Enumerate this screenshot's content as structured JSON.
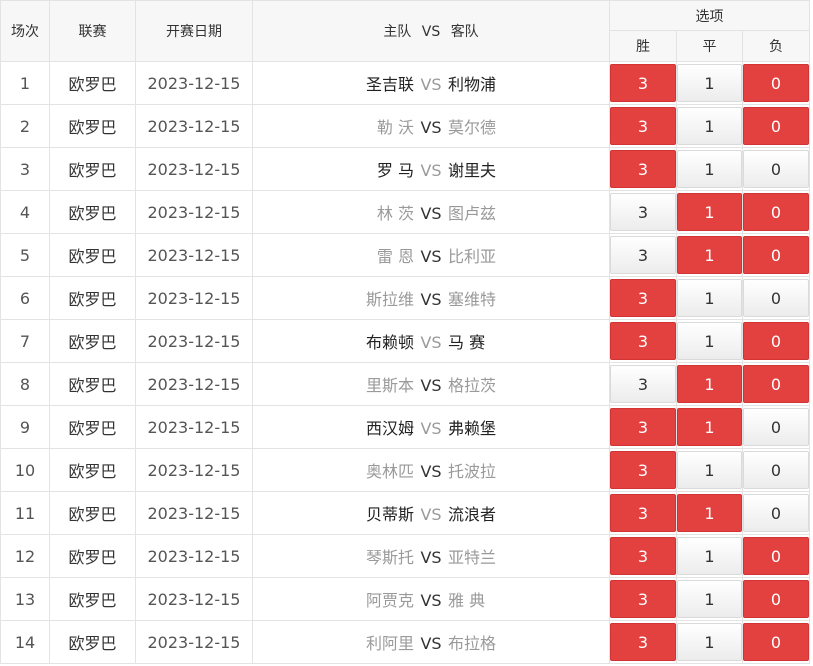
{
  "header": {
    "no": "场次",
    "league": "联赛",
    "date": "开赛日期",
    "home": "主队",
    "vs": "VS",
    "away": "客队",
    "options": "选项",
    "win": "胜",
    "draw": "平",
    "lose": "负"
  },
  "colors": {
    "selected": "#e34040",
    "unselected": "#f2f2f2",
    "border": "#e3e3e3",
    "header_bg": "#f7f7f7"
  },
  "rows": [
    {
      "no": "1",
      "league": "欧罗巴",
      "date": "2023-12-15",
      "home": "圣吉联",
      "away": "利物浦",
      "home_style": "dark",
      "away_style": "dark",
      "vs_style": "grey",
      "win": "3",
      "draw": "1",
      "lose": "0",
      "win_sel": true,
      "draw_sel": false,
      "lose_sel": true
    },
    {
      "no": "2",
      "league": "欧罗巴",
      "date": "2023-12-15",
      "home": "勒 沃",
      "away": "莫尔德",
      "home_style": "grey",
      "away_style": "grey",
      "vs_style": "dark",
      "win": "3",
      "draw": "1",
      "lose": "0",
      "win_sel": true,
      "draw_sel": false,
      "lose_sel": true
    },
    {
      "no": "3",
      "league": "欧罗巴",
      "date": "2023-12-15",
      "home": "罗 马",
      "away": "谢里夫",
      "home_style": "dark",
      "away_style": "dark",
      "vs_style": "grey",
      "win": "3",
      "draw": "1",
      "lose": "0",
      "win_sel": true,
      "draw_sel": false,
      "lose_sel": false
    },
    {
      "no": "4",
      "league": "欧罗巴",
      "date": "2023-12-15",
      "home": "林 茨",
      "away": "图卢兹",
      "home_style": "grey",
      "away_style": "grey",
      "vs_style": "dark",
      "win": "3",
      "draw": "1",
      "lose": "0",
      "win_sel": false,
      "draw_sel": true,
      "lose_sel": true
    },
    {
      "no": "5",
      "league": "欧罗巴",
      "date": "2023-12-15",
      "home": "雷 恩",
      "away": "比利亚",
      "home_style": "grey",
      "away_style": "grey",
      "vs_style": "dark",
      "win": "3",
      "draw": "1",
      "lose": "0",
      "win_sel": false,
      "draw_sel": true,
      "lose_sel": true
    },
    {
      "no": "6",
      "league": "欧罗巴",
      "date": "2023-12-15",
      "home": "斯拉维",
      "away": "塞维特",
      "home_style": "grey",
      "away_style": "grey",
      "vs_style": "dark",
      "win": "3",
      "draw": "1",
      "lose": "0",
      "win_sel": true,
      "draw_sel": false,
      "lose_sel": false
    },
    {
      "no": "7",
      "league": "欧罗巴",
      "date": "2023-12-15",
      "home": "布赖顿",
      "away": "马 赛",
      "home_style": "dark",
      "away_style": "dark",
      "vs_style": "grey",
      "win": "3",
      "draw": "1",
      "lose": "0",
      "win_sel": true,
      "draw_sel": false,
      "lose_sel": true
    },
    {
      "no": "8",
      "league": "欧罗巴",
      "date": "2023-12-15",
      "home": "里斯本",
      "away": "格拉茨",
      "home_style": "grey",
      "away_style": "grey",
      "vs_style": "dark",
      "win": "3",
      "draw": "1",
      "lose": "0",
      "win_sel": false,
      "draw_sel": true,
      "lose_sel": true
    },
    {
      "no": "9",
      "league": "欧罗巴",
      "date": "2023-12-15",
      "home": "西汉姆",
      "away": "弗赖堡",
      "home_style": "dark",
      "away_style": "dark",
      "vs_style": "grey",
      "win": "3",
      "draw": "1",
      "lose": "0",
      "win_sel": true,
      "draw_sel": true,
      "lose_sel": false
    },
    {
      "no": "10",
      "league": "欧罗巴",
      "date": "2023-12-15",
      "home": "奥林匹",
      "away": "托波拉",
      "home_style": "grey",
      "away_style": "grey",
      "vs_style": "dark",
      "win": "3",
      "draw": "1",
      "lose": "0",
      "win_sel": true,
      "draw_sel": false,
      "lose_sel": false
    },
    {
      "no": "11",
      "league": "欧罗巴",
      "date": "2023-12-15",
      "home": "贝蒂斯",
      "away": "流浪者",
      "home_style": "dark",
      "away_style": "dark",
      "vs_style": "grey",
      "win": "3",
      "draw": "1",
      "lose": "0",
      "win_sel": true,
      "draw_sel": true,
      "lose_sel": false
    },
    {
      "no": "12",
      "league": "欧罗巴",
      "date": "2023-12-15",
      "home": "琴斯托",
      "away": "亚特兰",
      "home_style": "grey",
      "away_style": "grey",
      "vs_style": "dark",
      "win": "3",
      "draw": "1",
      "lose": "0",
      "win_sel": true,
      "draw_sel": false,
      "lose_sel": true
    },
    {
      "no": "13",
      "league": "欧罗巴",
      "date": "2023-12-15",
      "home": "阿贾克",
      "away": "雅 典",
      "home_style": "grey",
      "away_style": "grey",
      "vs_style": "dark",
      "win": "3",
      "draw": "1",
      "lose": "0",
      "win_sel": true,
      "draw_sel": false,
      "lose_sel": true
    },
    {
      "no": "14",
      "league": "欧罗巴",
      "date": "2023-12-15",
      "home": "利阿里",
      "away": "布拉格",
      "home_style": "grey",
      "away_style": "grey",
      "vs_style": "dark",
      "win": "3",
      "draw": "1",
      "lose": "0",
      "win_sel": true,
      "draw_sel": false,
      "lose_sel": true
    }
  ]
}
